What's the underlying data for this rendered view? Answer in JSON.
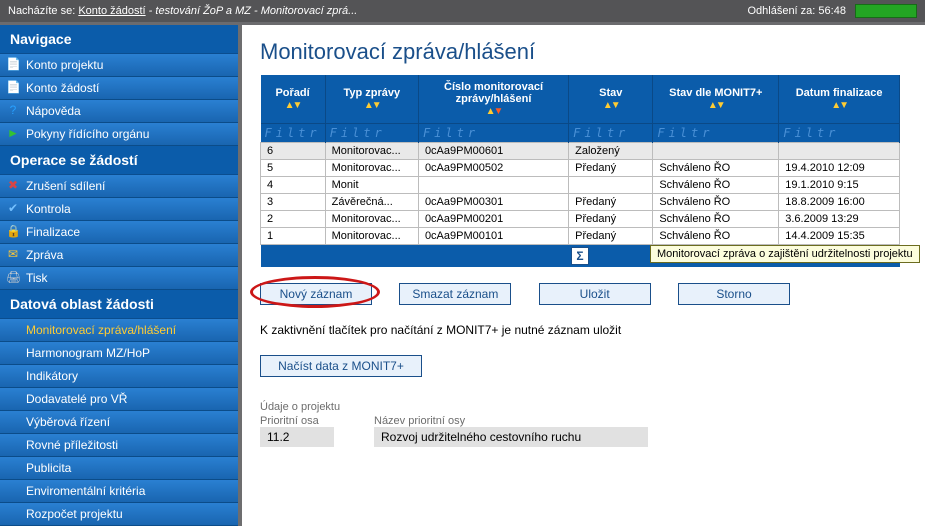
{
  "topbar": {
    "prefix": "Nacházíte se:",
    "link": "Konto žádostí",
    "rest": " - testování ŽoP a MZ - Monitorovací zprá...",
    "logout_label": "Odhlášení za:",
    "logout_time": "56:48"
  },
  "sidebar": {
    "section1": "Navigace",
    "items1": [
      {
        "label": "Konto projektu",
        "icon": "📄"
      },
      {
        "label": "Konto žádostí",
        "icon": "📄"
      },
      {
        "label": "Nápověda",
        "icon": "?",
        "icon_color": "#27a0ff"
      },
      {
        "label": "Pokyny řídícího orgánu",
        "icon": "►",
        "icon_color": "#33c233"
      }
    ],
    "section2": "Operace se žádostí",
    "items2": [
      {
        "label": "Zrušení sdílení",
        "icon": "✖",
        "icon_color": "#d84545"
      },
      {
        "label": "Kontrola",
        "icon": "✔",
        "icon_color": "#74c0ff"
      },
      {
        "label": "Finalizace",
        "icon": "🔒",
        "icon_color": "#ffb020"
      },
      {
        "label": "Zpráva",
        "icon": "✉",
        "icon_color": "#ffc733"
      },
      {
        "label": "Tisk",
        "icon": "🖨",
        "icon_color": "#cfcfcf"
      }
    ],
    "section3": "Datová oblast žádosti",
    "items3": [
      {
        "label": "Monitorovací zpráva/hlášení",
        "active": true
      },
      {
        "label": "Harmonogram MZ/HoP"
      },
      {
        "label": "Indikátory"
      },
      {
        "label": "Dodavatelé pro VŘ"
      },
      {
        "label": "Výběrová řízení"
      },
      {
        "label": "Rovné příležitosti"
      },
      {
        "label": "Publicita"
      },
      {
        "label": "Enviromentální kritéria"
      },
      {
        "label": "Rozpočet projektu"
      }
    ]
  },
  "page_title": "Monitorovací zpráva/hlášení",
  "table": {
    "headers": {
      "poradi": "Pořadí",
      "typ": "Typ zprávy",
      "cislo": "Číslo monitorovací\nzprávy/hlášení",
      "stav": "Stav",
      "stav_monit": "Stav dle MONIT7+",
      "datum": "Datum finalizace"
    },
    "filter_text": "Filtr",
    "rows": [
      {
        "poradi": "6",
        "typ": "Monitorovac...",
        "cislo": "0cAa9PM00601",
        "stav": "Založený",
        "stav_monit": "",
        "datum": "",
        "sel": true
      },
      {
        "poradi": "5",
        "typ": "Monitorovac...",
        "cislo": "0cAa9PM00502",
        "stav": "Předaný",
        "stav_monit": "Schváleno ŘO",
        "datum": "19.4.2010 12:09"
      },
      {
        "poradi": "4",
        "typ": "Monit",
        "cislo": "",
        "stav": "",
        "stav_monit": "Schváleno ŘO",
        "datum": "19.1.2010 9:15"
      },
      {
        "poradi": "3",
        "typ": "Závěrečná...",
        "cislo": "0cAa9PM00301",
        "stav": "Předaný",
        "stav_monit": "Schváleno ŘO",
        "datum": "18.8.2009 16:00"
      },
      {
        "poradi": "2",
        "typ": "Monitorovac...",
        "cislo": "0cAa9PM00201",
        "stav": "Předaný",
        "stav_monit": "Schváleno ŘO",
        "datum": "3.6.2009 13:29"
      },
      {
        "poradi": "1",
        "typ": "Monitorovac...",
        "cislo": "0cAa9PM00101",
        "stav": "Předaný",
        "stav_monit": "Schváleno ŘO",
        "datum": "14.4.2009 15:35"
      }
    ]
  },
  "tooltip": "Monitorovací zpráva o zajištění udržitelnosti projektu",
  "buttons": {
    "novy": "Nový záznam",
    "smazat": "Smazat záznam",
    "ulozit": "Uložit",
    "storno": "Storno",
    "nacist": "Načíst data z MONIT7+"
  },
  "subtext": "K zaktivnění tlačítek pro načítání z MONIT7+ je nutné záznam uložit",
  "project_section": {
    "title": "Údaje o projektu",
    "field1_label": "Prioritní osa",
    "field1_value": "11.2",
    "field2_label": "Název prioritní osy",
    "field2_value": "Rozvoj udržitelného cestovního ruchu"
  }
}
